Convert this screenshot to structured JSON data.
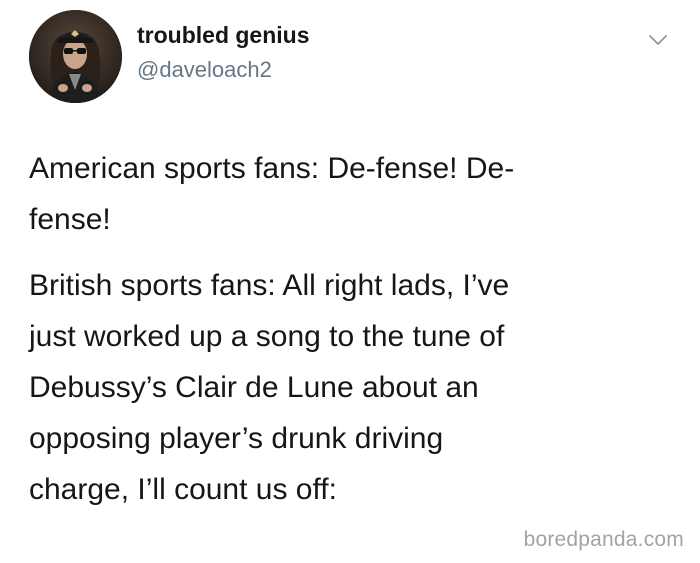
{
  "tweet": {
    "author": {
      "display_name": "troubled genius",
      "handle": "@daveloach2"
    },
    "paragraphs": [
      "American sports fans: De-fense! De-\nfense!",
      "British sports fans: All right lads, I’ve\njust worked up a song to the tune of\nDebussy’s Clair de Lune about an\nopposing player’s drunk driving\ncharge, I’ll count us off:"
    ],
    "menu_icon": "chevron-down-icon"
  },
  "watermark": {
    "text": "boredpanda.com"
  },
  "colors": {
    "text": "#14171a",
    "secondary": "#657786",
    "watermark": "#a3a3a3",
    "background": "#ffffff"
  }
}
